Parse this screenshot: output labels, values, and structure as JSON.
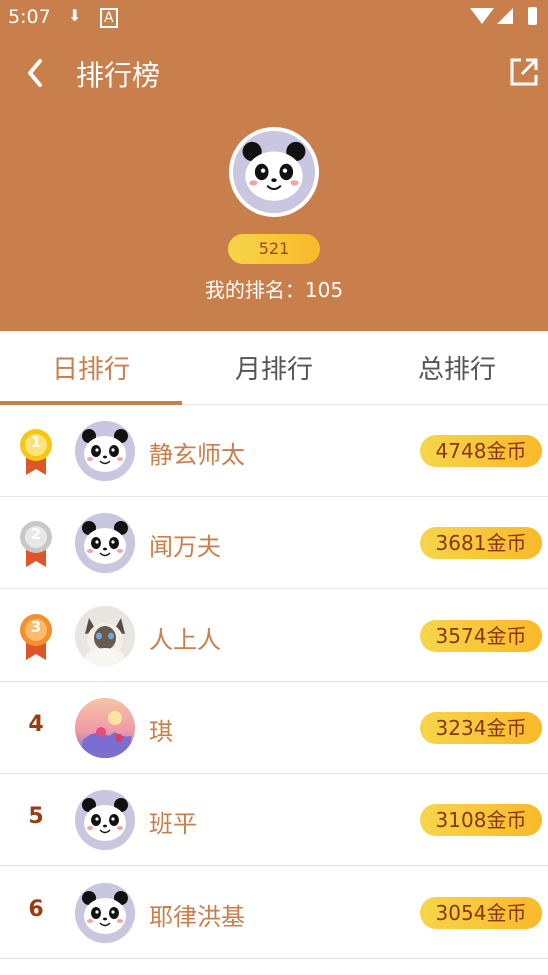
{
  "status_bar": {
    "time": "5:07"
  },
  "header": {
    "title": "排行榜",
    "my_coins": "521",
    "my_rank": "我的排名：105"
  },
  "tabs": [
    {
      "label": "日排行",
      "active": true
    },
    {
      "label": "月排行",
      "active": false
    },
    {
      "label": "总排行",
      "active": false
    }
  ],
  "rows": [
    {
      "rank": "1",
      "name": "静玄师太",
      "score": "4748金币",
      "avatar": "panda",
      "medal": "gold"
    },
    {
      "rank": "2",
      "name": "闻万夫",
      "score": "3681金币",
      "avatar": "panda",
      "medal": "silver"
    },
    {
      "rank": "3",
      "name": "人上人",
      "score": "3574金币",
      "avatar": "cat-photo",
      "medal": "bronze"
    },
    {
      "rank": "4",
      "name": "琪",
      "score": "3234金币",
      "avatar": "flower-photo",
      "medal": ""
    },
    {
      "rank": "5",
      "name": "班平",
      "score": "3108金币",
      "avatar": "panda",
      "medal": ""
    },
    {
      "rank": "6",
      "name": "耶律洪基",
      "score": "3054金币",
      "avatar": "panda",
      "medal": ""
    }
  ],
  "colors": {
    "header_bg": "#c87f4b",
    "accent": "#c87f4b",
    "coin_pill": "#f9b92a"
  }
}
